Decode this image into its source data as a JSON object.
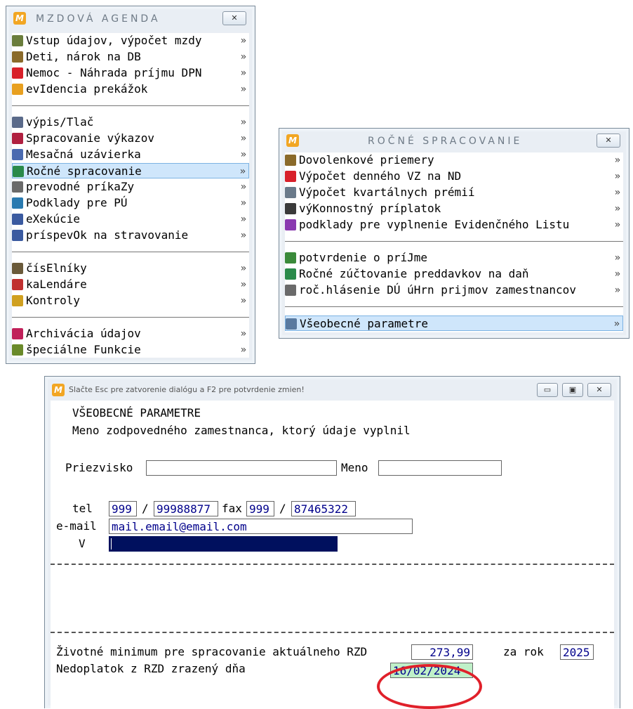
{
  "main_menu": {
    "title": "MZDOVÁ AGENDA",
    "close_glyph": "✕",
    "groups": [
      [
        {
          "label": "Vstup údajov, výpočet mzdy",
          "icon": "edit-icon",
          "color": "#6a7d3c"
        },
        {
          "label": "Deti, nárok na DB",
          "icon": "children-icon",
          "color": "#8a6a2a"
        },
        {
          "label": "Nemoc - Náhrada príjmu DPN",
          "icon": "medical-cross-icon",
          "color": "#d8202a"
        },
        {
          "label": "evIdencia prekážok",
          "icon": "obstacle-icon",
          "color": "#e8a020"
        }
      ],
      [
        {
          "label": "výpis/Tlač",
          "icon": "print-icon",
          "color": "#5a6a8a"
        },
        {
          "label": "Spracovanie výkazov",
          "icon": "books-icon",
          "color": "#b02040"
        },
        {
          "label": "Mesačná uzávierka",
          "icon": "calendar-icon",
          "color": "#4a6ab0"
        },
        {
          "label": "Ročné spracovanie",
          "icon": "globe-icon",
          "color": "#2a8a4a",
          "selected": true
        },
        {
          "label": "prevodné príkaZy",
          "icon": "bank-icon",
          "color": "#6a6a6a"
        },
        {
          "label": "Podklady pre PÚ",
          "icon": "search-person-icon",
          "color": "#2a7ab0"
        },
        {
          "label": "eXekúcie",
          "icon": "pen-icon",
          "color": "#3a5aa0"
        },
        {
          "label": "príspevOk na stravovanie",
          "icon": "meal-icon",
          "color": "#3a5aa0"
        }
      ],
      [
        {
          "label": "čísElníky",
          "icon": "list-icon",
          "color": "#6a5a3a"
        },
        {
          "label": "kaLendáre",
          "icon": "calendar-day-icon",
          "color": "#c03030"
        },
        {
          "label": "Kontroly",
          "icon": "check-icon",
          "color": "#d0a020"
        }
      ],
      [
        {
          "label": "Archivácia údajov",
          "icon": "floppy-icon",
          "color": "#c0205a"
        },
        {
          "label": "špeciálne Funkcie",
          "icon": "tools-icon",
          "color": "#6a8a2a"
        }
      ]
    ],
    "arrow": "»"
  },
  "annual_menu": {
    "title": "ROČNÉ SPRACOVANIE",
    "close_glyph": "✕",
    "groups": [
      [
        {
          "label": "Dovolenkové priemery",
          "icon": "vacation-icon",
          "color": "#8a6a2a"
        },
        {
          "label": "Výpočet denného VZ na ND",
          "icon": "medical-cross-icon",
          "color": "#d8202a"
        },
        {
          "label": "Výpočet kvartálnych prémií",
          "icon": "chart-icon",
          "color": "#6a7a8a"
        },
        {
          "label": "výKonnostný príplatok",
          "icon": "hammer-icon",
          "color": "#3a3a3a"
        },
        {
          "label": "podklady pre vyplnenie Evidenčného Listu",
          "icon": "document-icon",
          "color": "#8a3ab0"
        }
      ],
      [
        {
          "label": "potvrdenie o príJme",
          "icon": "approve-icon",
          "color": "#3a8a3a"
        },
        {
          "label": "Ročné zúčtovanie preddavkov na daň",
          "icon": "globe-icon",
          "color": "#2a8a4a"
        },
        {
          "label": "roč.hlásenie DÚ úHrn prijmov zamestnancov",
          "icon": "bank-icon",
          "color": "#6a6a6a"
        }
      ],
      [
        {
          "label": "Všeobecné parametre",
          "icon": "settings-icon",
          "color": "#5a7aa0",
          "selected": true
        }
      ]
    ],
    "arrow": "»"
  },
  "dialog": {
    "title": "Slačte Esc pre zatvorenie dialógu a F2 pre potvrdenie zmien!",
    "buttons": {
      "minimize": "▭",
      "maximize": "▣",
      "close": "✕"
    },
    "heading": "VŠEOBECNÉ PARAMETRE",
    "subheading": "Meno zodpovedného zamestnanca, ktorý údaje vyplnil",
    "surname_label": "Priezvisko",
    "surname_value": "",
    "name_label": "Meno",
    "name_value": "",
    "tel_label": "tel",
    "tel_prefix": "999",
    "slash": "/",
    "tel_number": "99988877",
    "fax_label": "fax",
    "fax_prefix": "999",
    "fax_number": "87465322",
    "email_label": "e-mail",
    "email_value": "mail.email@email.com",
    "place_label": "V",
    "place_value": "",
    "min_label": "Životné minimum pre spracovanie aktuálneho RZD",
    "min_value": "273,99",
    "year_label": "za rok",
    "year_value": "2025",
    "underpay_label": "Nedoplatok z RZD zrazený dňa",
    "underpay_date": "16/02/2024",
    "highlight_color": "#e0202a"
  }
}
